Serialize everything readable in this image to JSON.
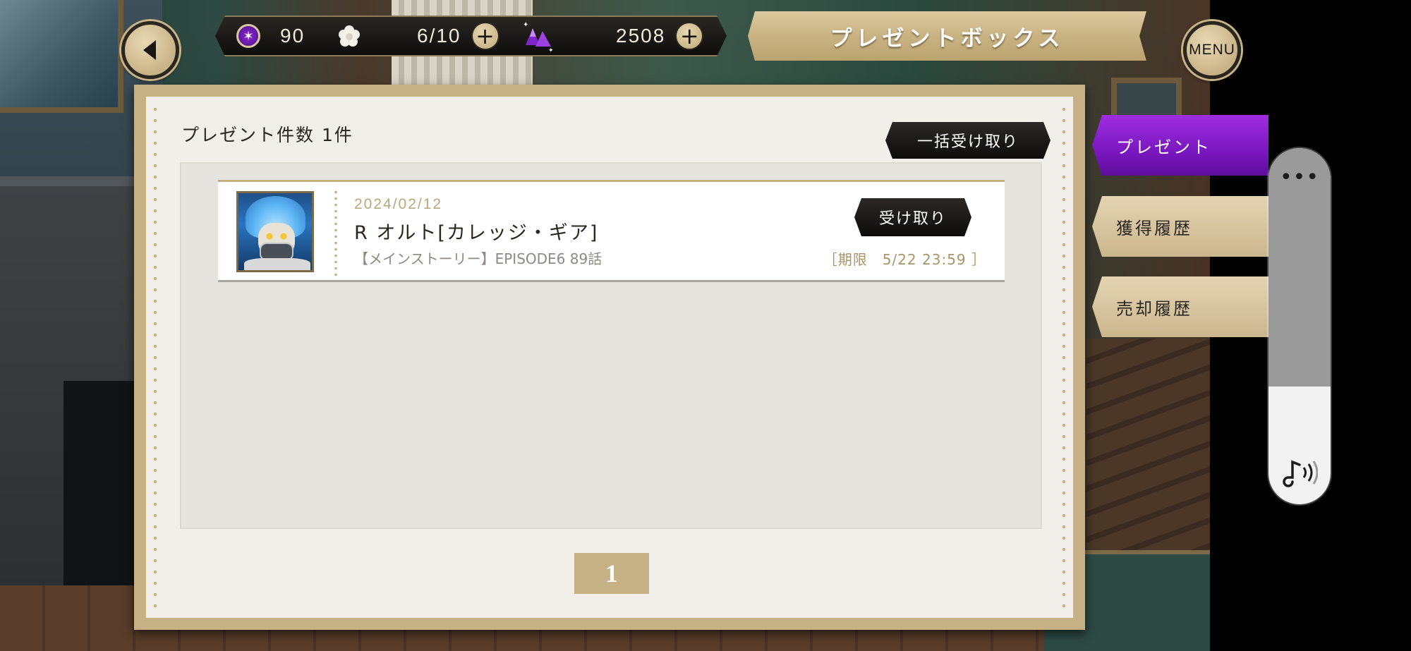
{
  "header": {
    "title": "プレゼントボックス",
    "menu_label": "MENU"
  },
  "resources": {
    "gems": "90",
    "stamina": "6/10",
    "crystals": "2508"
  },
  "panel": {
    "count_label": "プレゼント件数 1件",
    "bulk_receive_label": "一括受け取り",
    "page": "1"
  },
  "presents": [
    {
      "date": "2024/02/12",
      "name": "R オルト[カレッジ・ギア]",
      "source": "【メインストーリー】EPISODE6 89話",
      "receive_label": "受け取り",
      "deadline": "［期限　5/22 23:59 ］"
    }
  ],
  "side_tabs": [
    {
      "label": "プレゼント",
      "active": true
    },
    {
      "label": "獲得履歴",
      "active": false
    },
    {
      "label": "売却履歴",
      "active": false
    }
  ],
  "volume": {
    "level": 0.33,
    "more_label": "•••"
  },
  "colors": {
    "accent_gold": "#c5b184",
    "active_tab_purple": "#7a17c0"
  },
  "icons": {
    "back": "back-arrow-icon",
    "gem": "gem-icon",
    "stamina": "flower-icon",
    "crystal": "crystal-icon",
    "plus": "plus-icon",
    "volume": "music-note-sound-icon"
  }
}
